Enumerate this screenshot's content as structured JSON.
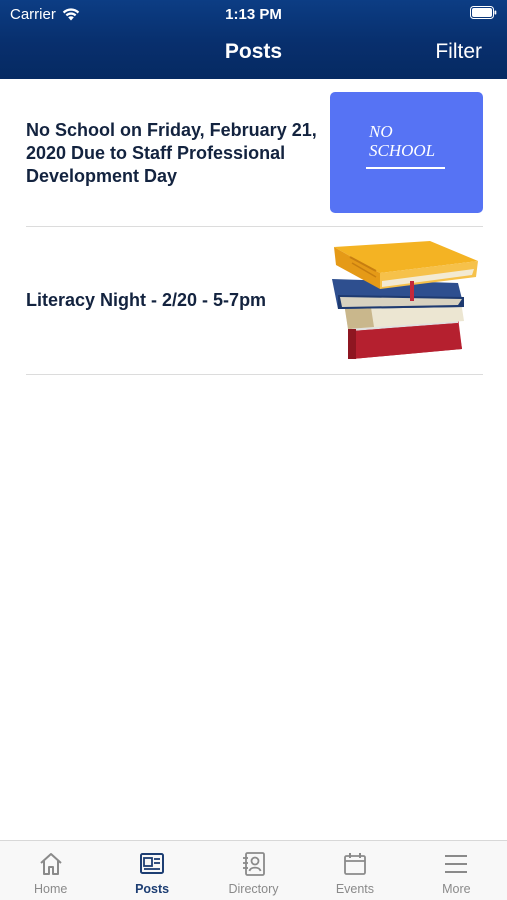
{
  "status_bar": {
    "carrier": "Carrier",
    "time": "1:13 PM"
  },
  "nav": {
    "title": "Posts",
    "filter_label": "Filter"
  },
  "posts": [
    {
      "title": "No School on Friday, February 21, 2020 Due to Staff Professional Development Day",
      "thumbnail_text": "NO\nSCHOOL",
      "thumbnail_color": "#5673f4"
    },
    {
      "title": "Literacy Night - 2/20 - 5-7pm",
      "thumbnail_icon": "books-stack-image"
    }
  ],
  "tabs": [
    {
      "label": "Home",
      "icon": "home-icon",
      "active": false
    },
    {
      "label": "Posts",
      "icon": "posts-icon",
      "active": true
    },
    {
      "label": "Directory",
      "icon": "directory-icon",
      "active": false
    },
    {
      "label": "Events",
      "icon": "calendar-icon",
      "active": false
    },
    {
      "label": "More",
      "icon": "menu-icon",
      "active": false
    }
  ],
  "colors": {
    "header": "#0a3778",
    "active_tab": "#1d3e73",
    "inactive_tab": "#8a8a8a",
    "post_title": "#13233f"
  }
}
